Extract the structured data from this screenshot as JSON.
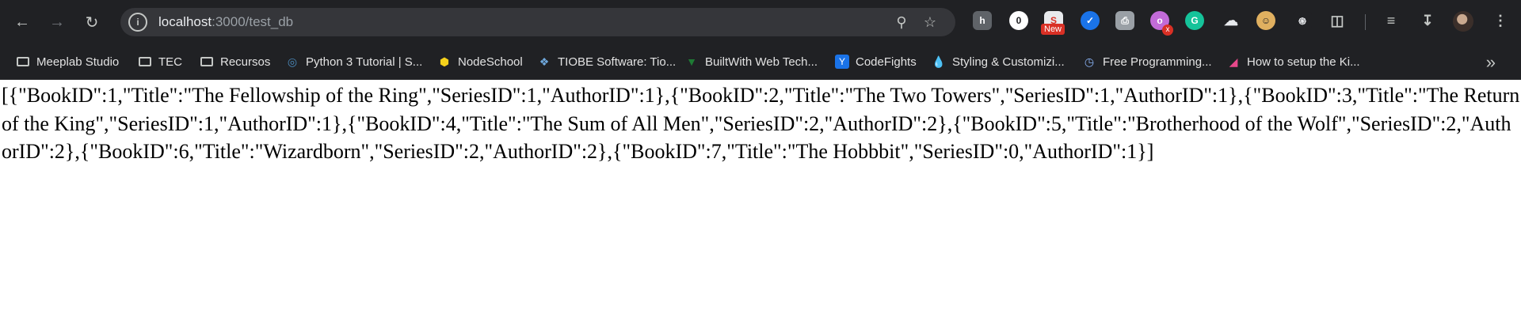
{
  "browser": {
    "url_host": "localhost",
    "url_rest": ":3000/test_db",
    "new_badge": "New",
    "x_badge": "x"
  },
  "bookmarks": [
    {
      "label": "Meeplab Studio",
      "icon": "folder-icon"
    },
    {
      "label": "TEC",
      "icon": "folder-icon"
    },
    {
      "label": "Recursos",
      "icon": "folder-icon"
    },
    {
      "label": "Python 3 Tutorial | S...",
      "icon": "python-icon"
    },
    {
      "label": "NodeSchool",
      "icon": "hexagon-icon"
    },
    {
      "label": "TIOBE Software: Tio...",
      "icon": "tiobe-icon"
    },
    {
      "label": "BuiltWith Web Tech...",
      "icon": "builtwith-icon"
    },
    {
      "label": "CodeFights",
      "icon": "codefights-icon"
    },
    {
      "label": "Styling & Customizi...",
      "icon": "drop-icon"
    },
    {
      "label": "Free Programming...",
      "icon": "wifi-icon"
    },
    {
      "label": "How to setup the Ki...",
      "icon": "kibana-icon"
    }
  ],
  "page": {
    "json_text": "[{\"BookID\":1,\"Title\":\"The Fellowship of the Ring\",\"SeriesID\":1,\"AuthorID\":1},{\"BookID\":2,\"Title\":\"The Two Towers\",\"SeriesID\":1,\"AuthorID\":1},{\"BookID\":3,\"Title\":\"The Return of the King\",\"SeriesID\":1,\"AuthorID\":1},{\"BookID\":4,\"Title\":\"The Sum of All Men\",\"SeriesID\":2,\"AuthorID\":2},{\"BookID\":5,\"Title\":\"Brotherhood of the Wolf\",\"SeriesID\":2,\"AuthorID\":2},{\"BookID\":6,\"Title\":\"Wizardborn\",\"SeriesID\":2,\"AuthorID\":2},{\"BookID\":7,\"Title\":\"The Hobbbit\",\"SeriesID\":0,\"AuthorID\":1}]"
  }
}
